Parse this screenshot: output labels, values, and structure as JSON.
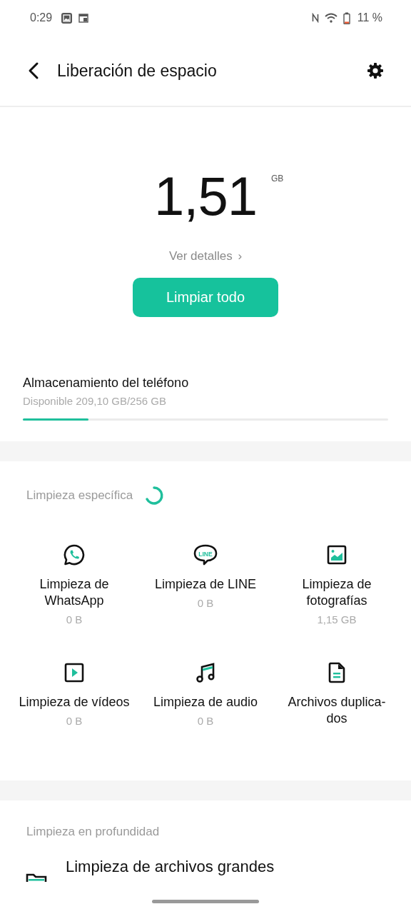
{
  "status_bar": {
    "time": "0:29",
    "battery": "11 %"
  },
  "header": {
    "title": "Liberación de espacio"
  },
  "summary": {
    "amount": "1,51",
    "unit": "GB",
    "details_link": "Ver detalles",
    "details_arrow": "›",
    "button": "Limpiar todo"
  },
  "storage": {
    "title": "Almacenamiento del teléfono",
    "subtitle": "Disponible 209,10 GB/256 GB",
    "level": 0.18
  },
  "specific": {
    "label": "Limpieza específica",
    "loading": true,
    "items": [
      {
        "kind": "whatsapp",
        "title": "Limpieza de\nWhatsApp",
        "size": "0 B"
      },
      {
        "kind": "line",
        "icon_text": "LINE",
        "title": "Limpieza de LINE",
        "size": "0 B"
      },
      {
        "kind": "photo",
        "title": "Limpieza de\nfotografías",
        "size": "1,15 GB"
      },
      {
        "kind": "video",
        "title": "Limpieza de vídeos",
        "size": "0 B"
      },
      {
        "kind": "audio",
        "title": "Limpieza de audio",
        "size": "0 B"
      },
      {
        "kind": "document",
        "title": "Archivos duplica-\ndos"
      }
    ]
  },
  "deep": {
    "label": "Limpieza en profundidad",
    "items": [
      {
        "kind": "folder",
        "title": "Limpieza de archivos grandes"
      }
    ]
  }
}
